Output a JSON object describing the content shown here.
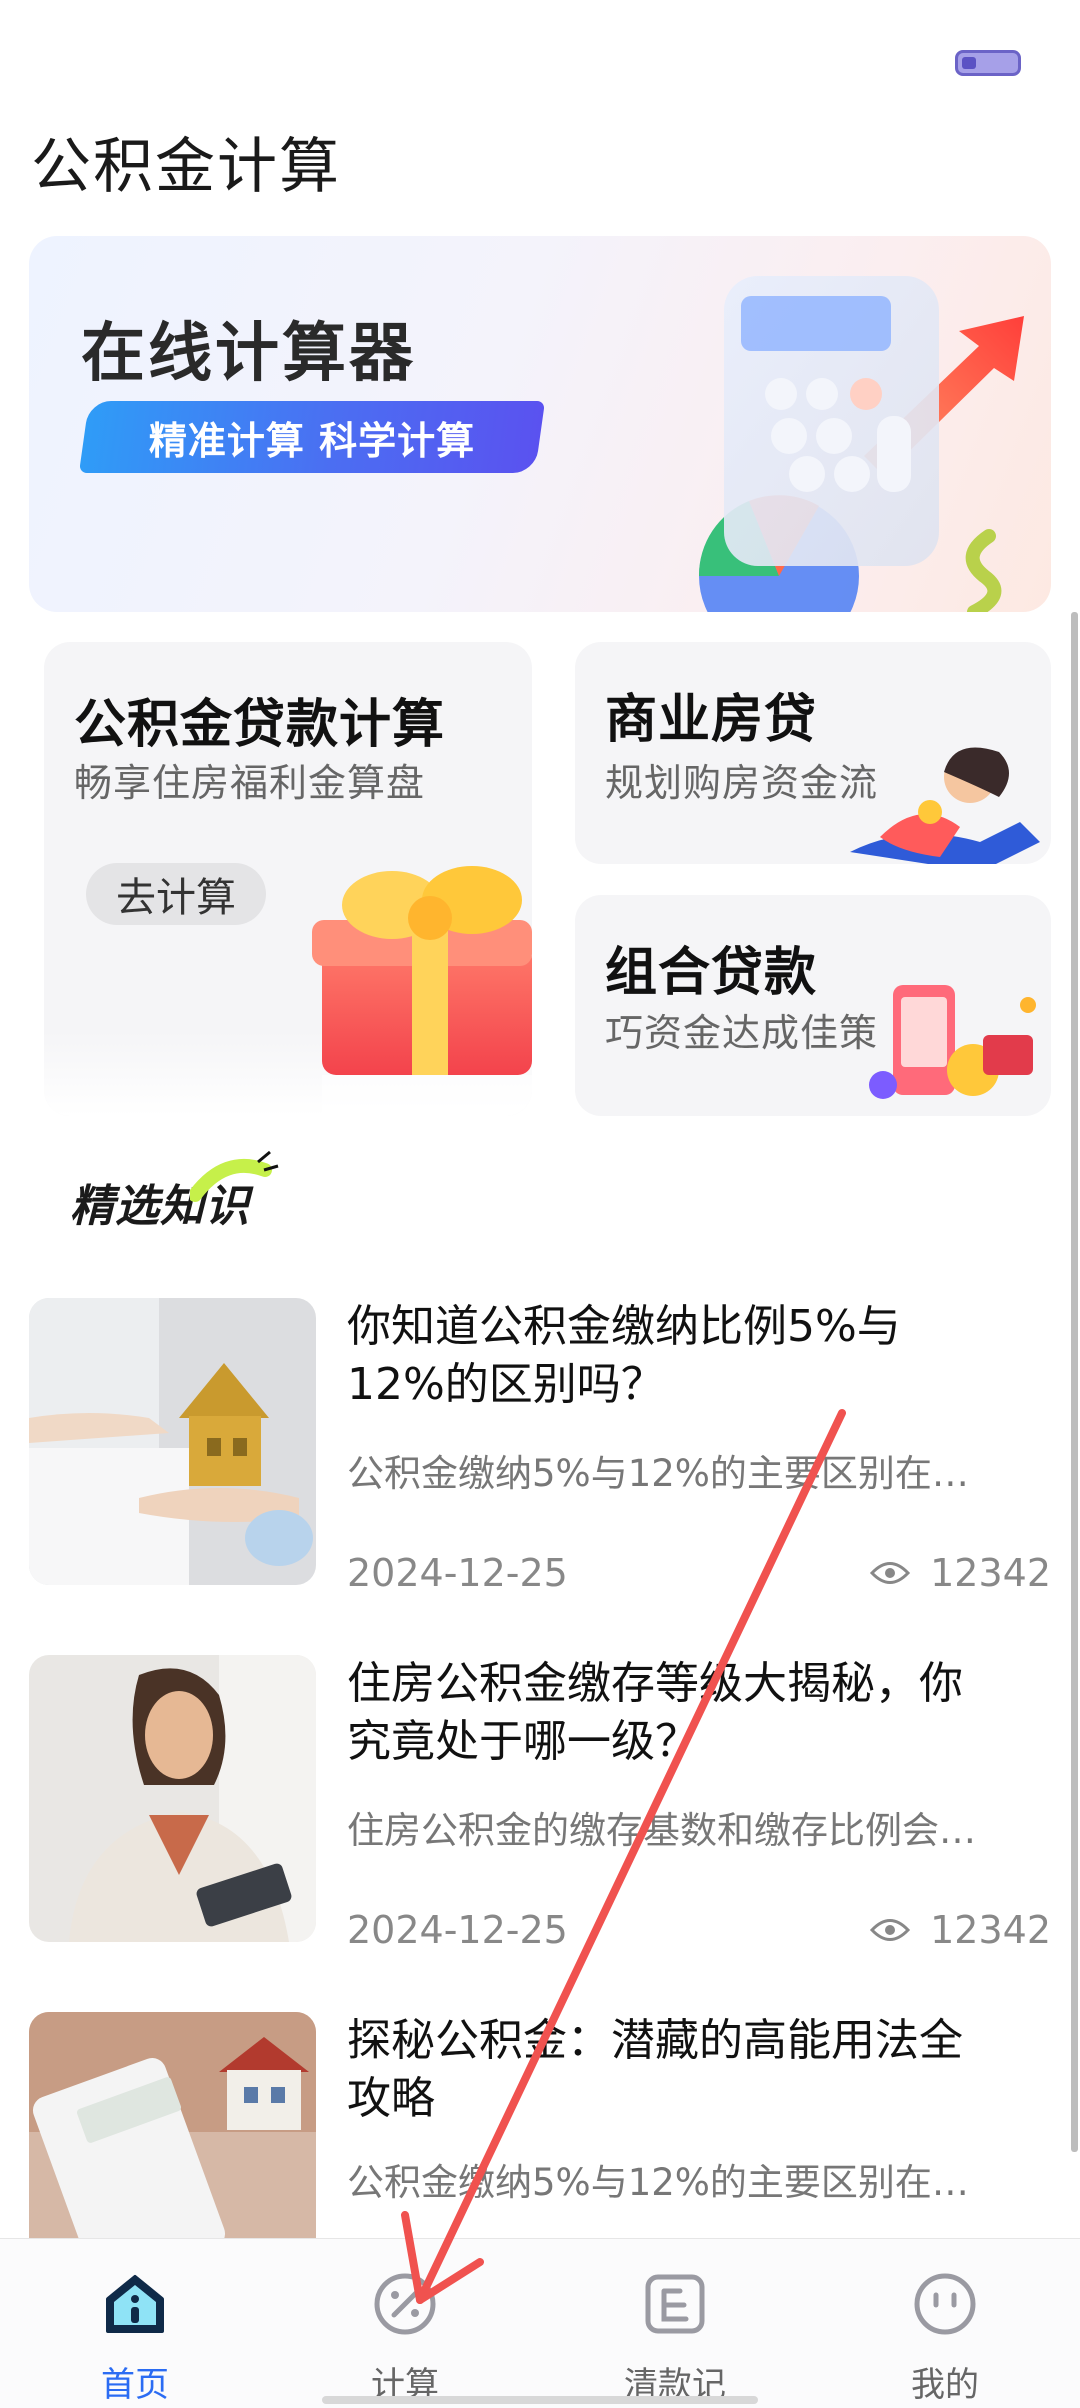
{
  "header": {
    "title": "公积金计算"
  },
  "banner": {
    "title": "在线计算器",
    "tag": "精准计算  科学计算"
  },
  "cards": {
    "main": {
      "title": "公积金贷款计算",
      "subtitle": "畅享住房福利金算盘",
      "button": "去计算"
    },
    "business": {
      "title": "商业房贷",
      "subtitle": "规划购房资金流"
    },
    "combo": {
      "title": "组合贷款",
      "subtitle": "巧资金达成佳策"
    }
  },
  "section": {
    "title": "精选知识"
  },
  "articles": [
    {
      "title": "你知道公积金缴纳比例5%与12%的区别吗？",
      "desc": "公积金缴纳5%与12%的主要区别在…",
      "date": "2024-12-25",
      "views": "12342"
    },
    {
      "title": "住房公积金缴存等级大揭秘，你究竟处于哪一级？",
      "desc": "住房公积金的缴存基数和缴存比例会…",
      "date": "2024-12-25",
      "views": "12342"
    },
    {
      "title": "探秘公积金：潜藏的高能用法全攻略",
      "desc": "公积金缴纳5%与12%的主要区别在…"
    }
  ],
  "nav": {
    "items": [
      {
        "label": "首页",
        "icon": "home-icon",
        "active": true
      },
      {
        "label": "计算",
        "icon": "calculate-icon",
        "active": false
      },
      {
        "label": "清款记",
        "icon": "ledger-icon",
        "active": false
      },
      {
        "label": "我的",
        "icon": "profile-icon",
        "active": false
      }
    ]
  },
  "colors": {
    "accent": "#2b6cf3",
    "annotation": "#f0524f"
  }
}
